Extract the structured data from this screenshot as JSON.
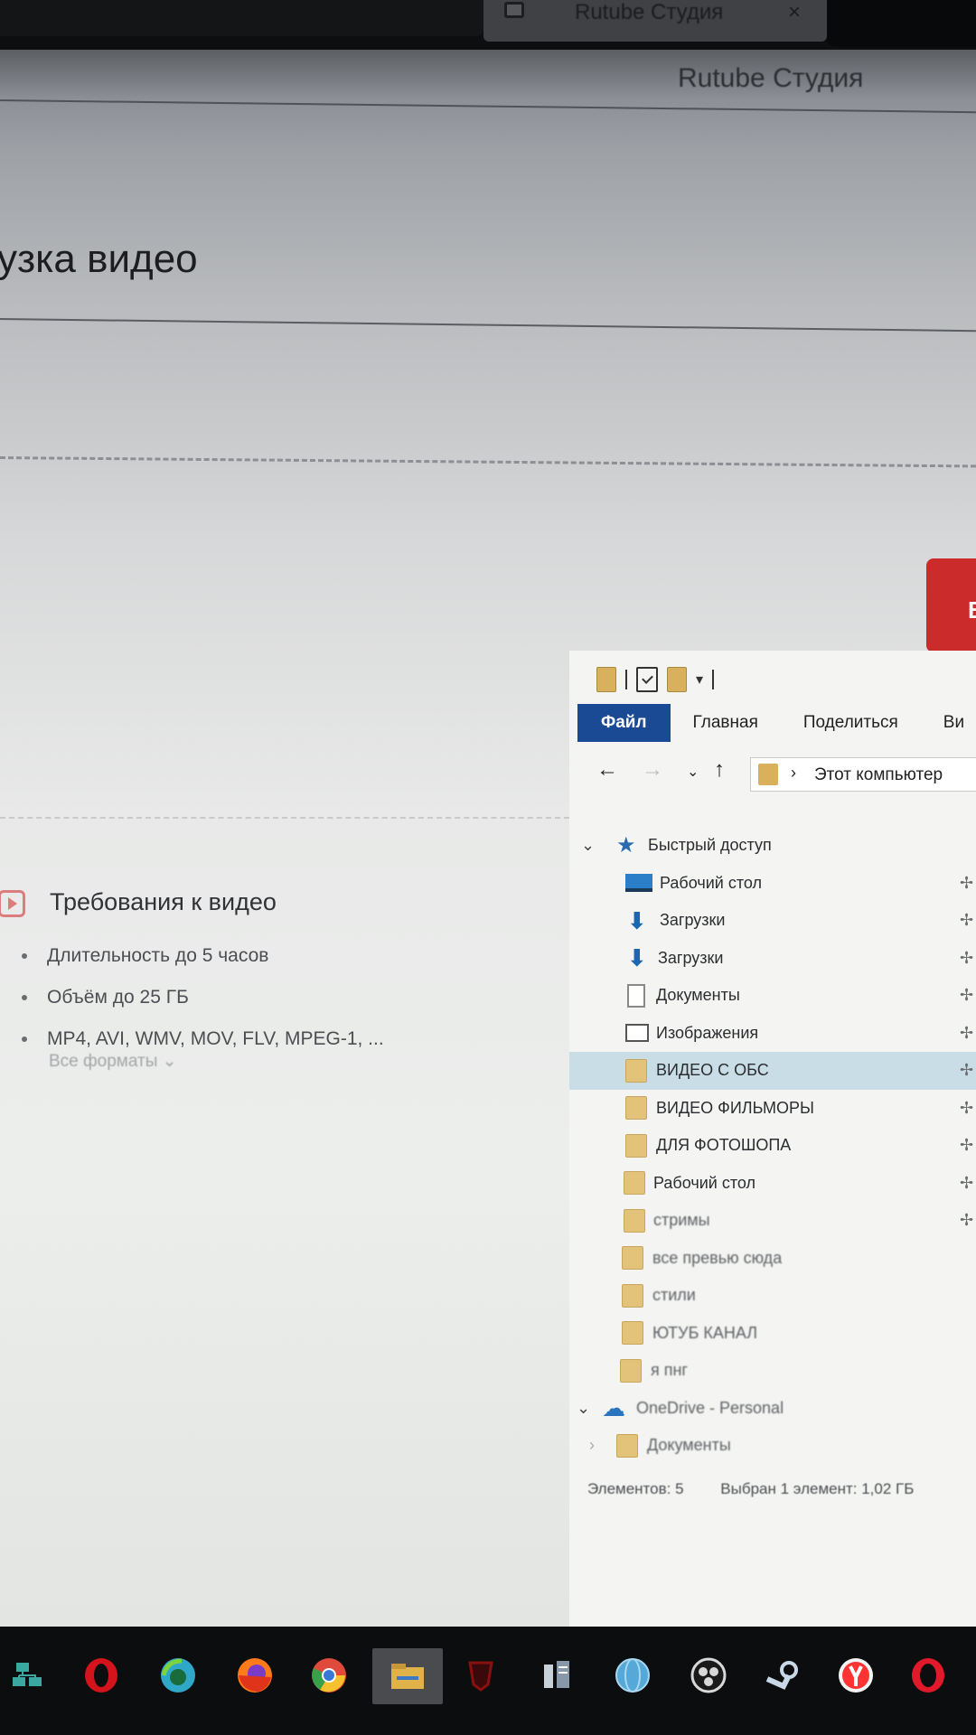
{
  "browser": {
    "tab_title": "Rutube Студия",
    "tab_close": "×"
  },
  "header": {
    "brand": "Rutube Студия"
  },
  "page": {
    "title": "узка видео",
    "select_button_label": "В"
  },
  "requirements": {
    "title": "Требования к видео",
    "items": [
      "Длительность до 5 часов",
      "Объём до 25 ГБ",
      "MP4, AVI, WMV, MOV, FLV, MPEG-1, ..."
    ],
    "all_formats": "Все форматы ⌄"
  },
  "explorer": {
    "ribbon_tabs": [
      "Файл",
      "Главная",
      "Поделиться",
      "Ви"
    ],
    "address_path": "Этот компьютер",
    "tree": {
      "quick_access": "Быстрый доступ",
      "items": [
        {
          "label": "Рабочий стол",
          "icon": "desktop-icon",
          "pinned": true
        },
        {
          "label": "Загрузки",
          "icon": "download-icon",
          "pinned": true
        },
        {
          "label": "Загрузки",
          "icon": "download-icon",
          "pinned": true
        },
        {
          "label": "Документы",
          "icon": "document-icon",
          "pinned": true
        },
        {
          "label": "Изображения",
          "icon": "pictures-icon",
          "pinned": true
        },
        {
          "label": "ВИДЕО С ОБС",
          "icon": "folder-icon",
          "pinned": true,
          "selected": true
        },
        {
          "label": "ВИДЕО ФИЛЬМОРЫ",
          "icon": "folder-icon",
          "pinned": true
        },
        {
          "label": "ДЛЯ ФОТОШОПА",
          "icon": "folder-icon",
          "pinned": true
        },
        {
          "label": "Рабочий стол",
          "icon": "folder-icon",
          "pinned": true
        },
        {
          "label": "стримы",
          "icon": "folder-icon",
          "pinned": true
        },
        {
          "label": "все превью сюда",
          "icon": "folder-icon",
          "pinned": false
        },
        {
          "label": "стили",
          "icon": "folder-icon",
          "pinned": false
        },
        {
          "label": "ЮТУБ КАНАЛ",
          "icon": "folder-icon",
          "pinned": false
        },
        {
          "label": "я пнг",
          "icon": "folder-icon",
          "pinned": false
        }
      ],
      "onedrive": "OneDrive - Personal",
      "onedrive_child": "Документы"
    },
    "status": {
      "count": "Элементов: 5",
      "selection": "Выбран 1 элемент: 1,02 ГБ"
    }
  },
  "taskbar": {
    "apps": [
      {
        "name": "network-icon",
        "color": "#3aa8a0"
      },
      {
        "name": "opera-icon",
        "color": "#d3141c"
      },
      {
        "name": "edge-icon",
        "color": "#2fa7c8"
      },
      {
        "name": "firefox-icon",
        "color": "#ff7a18"
      },
      {
        "name": "chrome-icon",
        "color": "#e04a3a"
      },
      {
        "name": "file-explorer-icon",
        "color": "#e0b24a"
      },
      {
        "name": "shield-app-icon",
        "color": "#8a1010"
      },
      {
        "name": "document-app-icon",
        "color": "#c8d0d8"
      },
      {
        "name": "globe-icon",
        "color": "#56a8d8"
      },
      {
        "name": "obs-icon",
        "color": "#d8d8d8"
      },
      {
        "name": "steam-icon",
        "color": "#c8d8e8"
      },
      {
        "name": "yandex-browser-icon",
        "color": "#ff3333"
      },
      {
        "name": "opera-gx-icon",
        "color": "#e01a2a"
      }
    ]
  }
}
